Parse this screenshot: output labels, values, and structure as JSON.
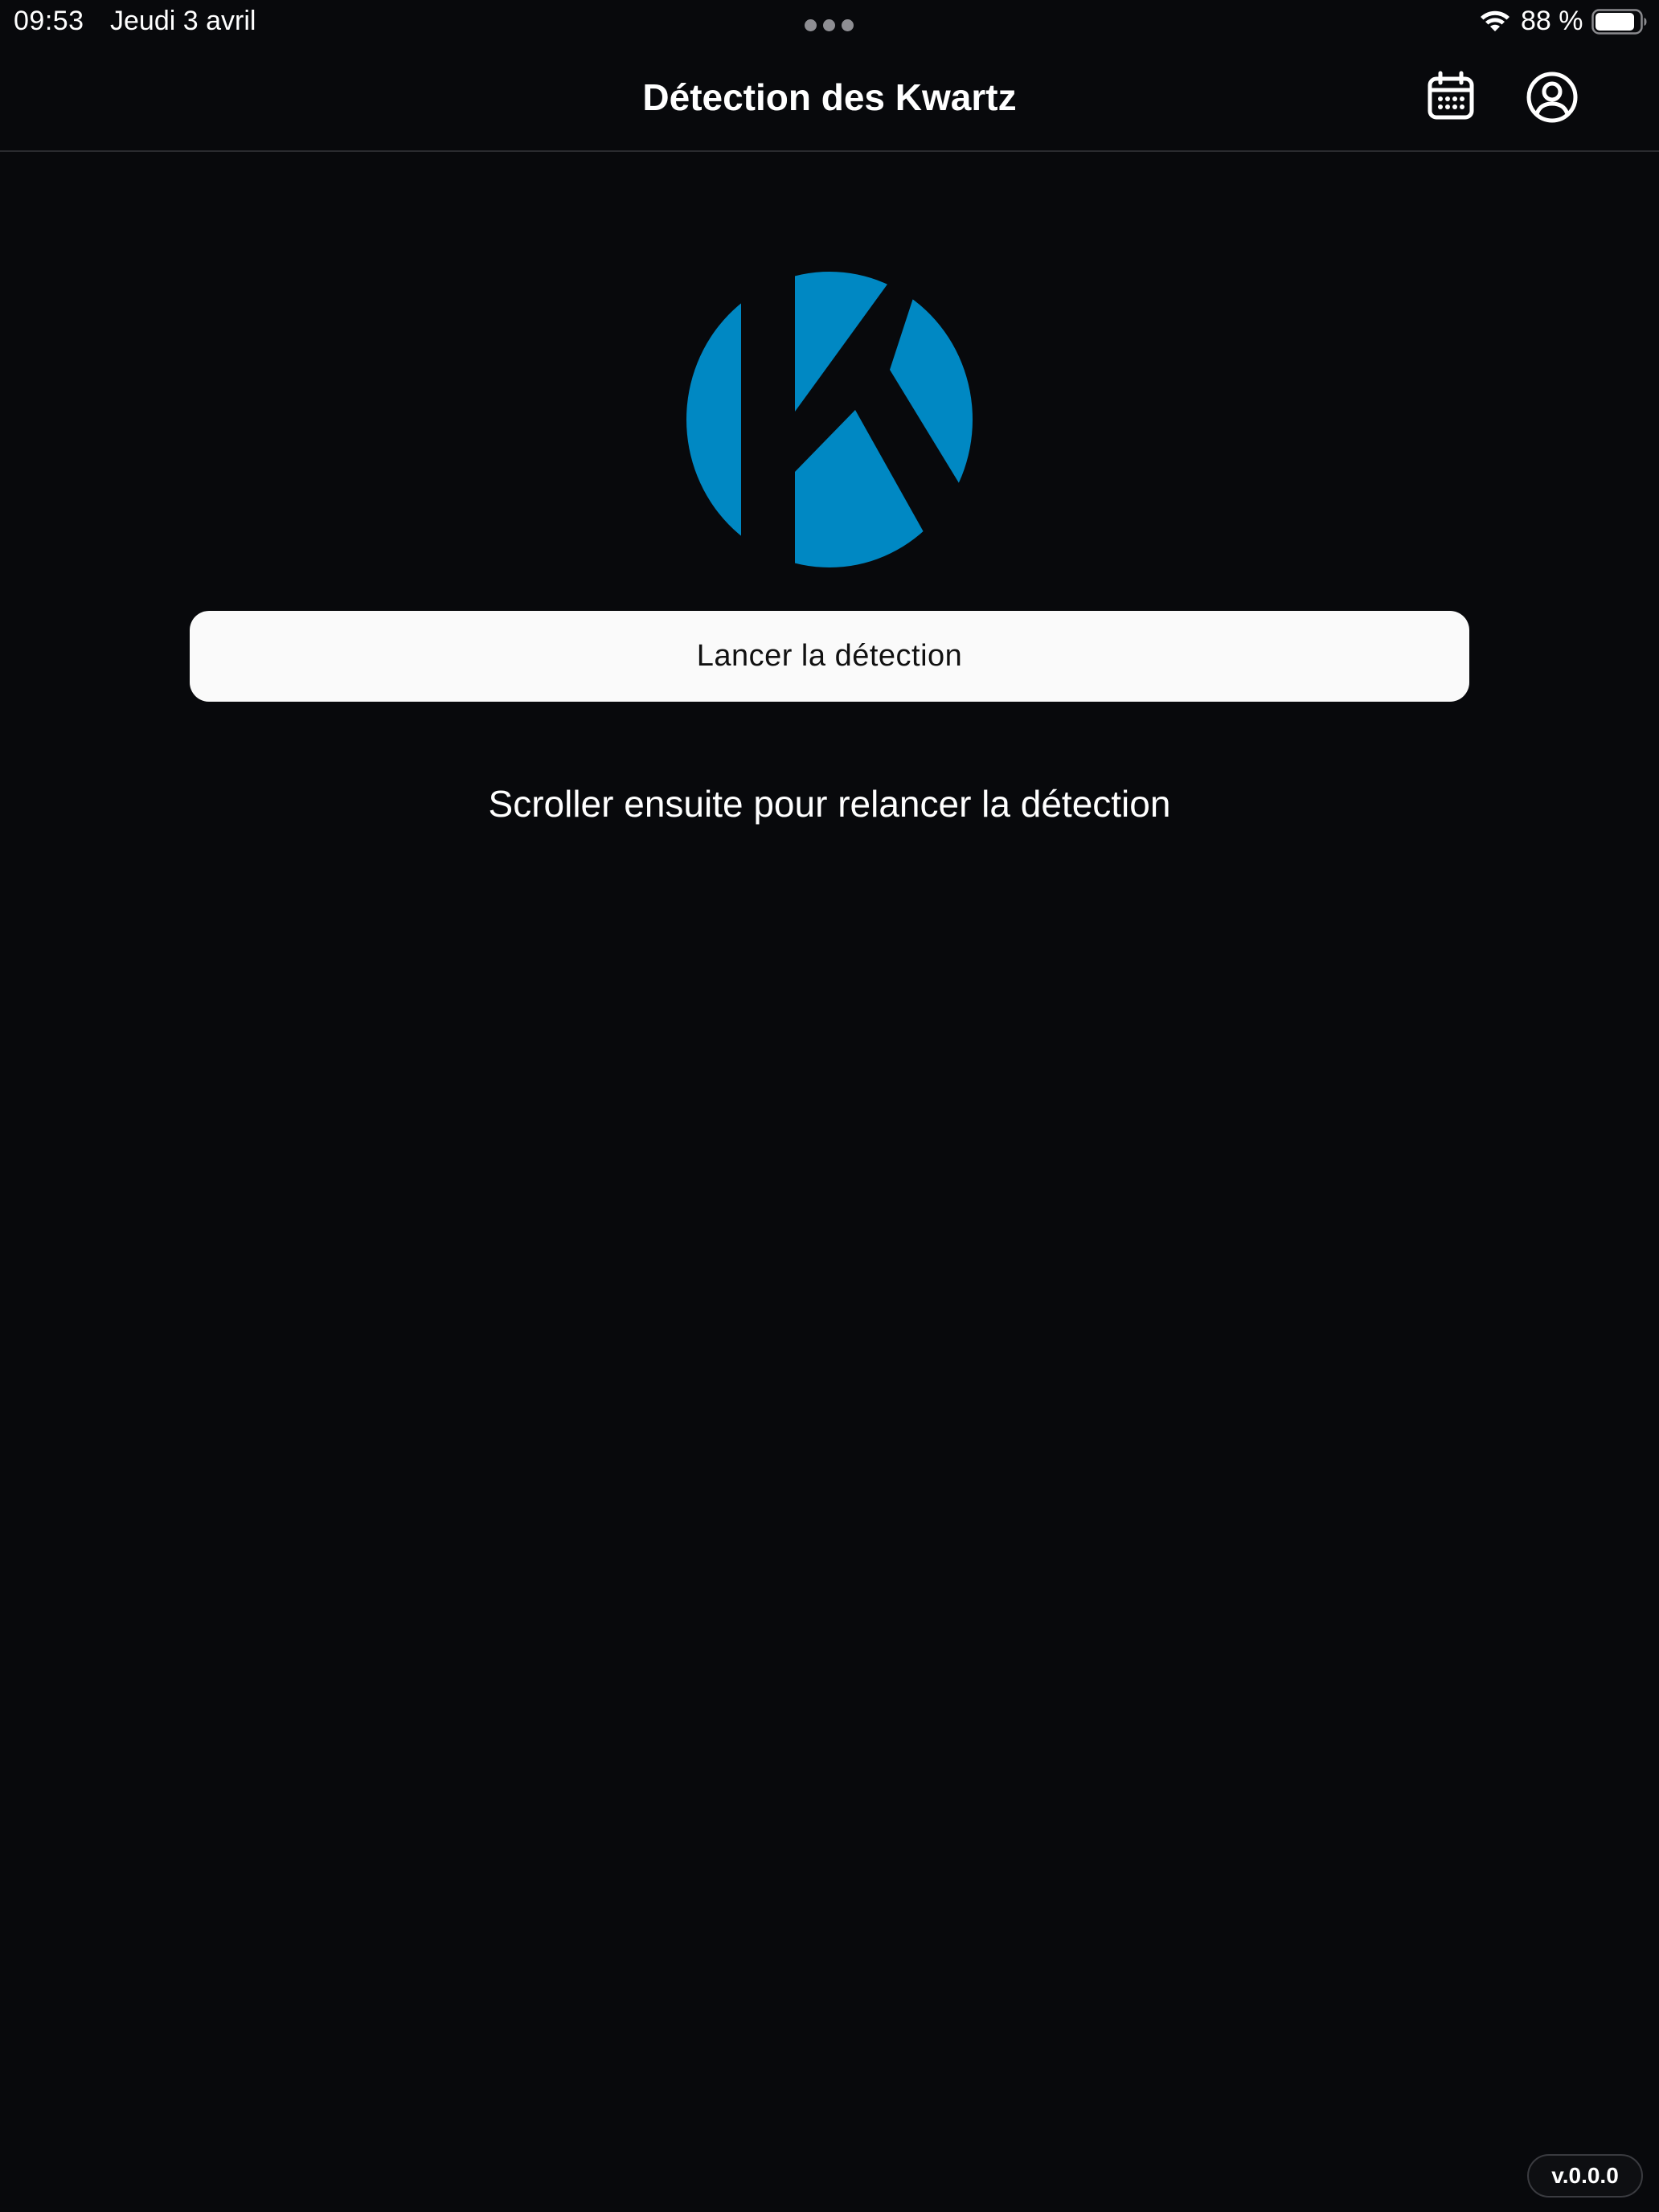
{
  "status_bar": {
    "time": "09:53",
    "date": "Jeudi 3 avril",
    "battery_percent": "88 %",
    "battery_level": 0.88,
    "wifi_icon": "wifi-icon",
    "battery_icon": "battery-icon"
  },
  "nav": {
    "title": "Détection des Kwartz",
    "calendar_icon": "calendar-icon",
    "profile_icon": "user-circle-icon"
  },
  "main": {
    "logo_icon": "kwartz-logo",
    "detect_button_label": "Lancer la détection",
    "hint": "Scroller ensuite pour relancer la détection"
  },
  "footer": {
    "version": "v.0.0.0"
  },
  "colors": {
    "background": "#08090c",
    "brand_blue": "#0088c3",
    "button_bg": "#fafafa",
    "text": "#ffffff"
  }
}
